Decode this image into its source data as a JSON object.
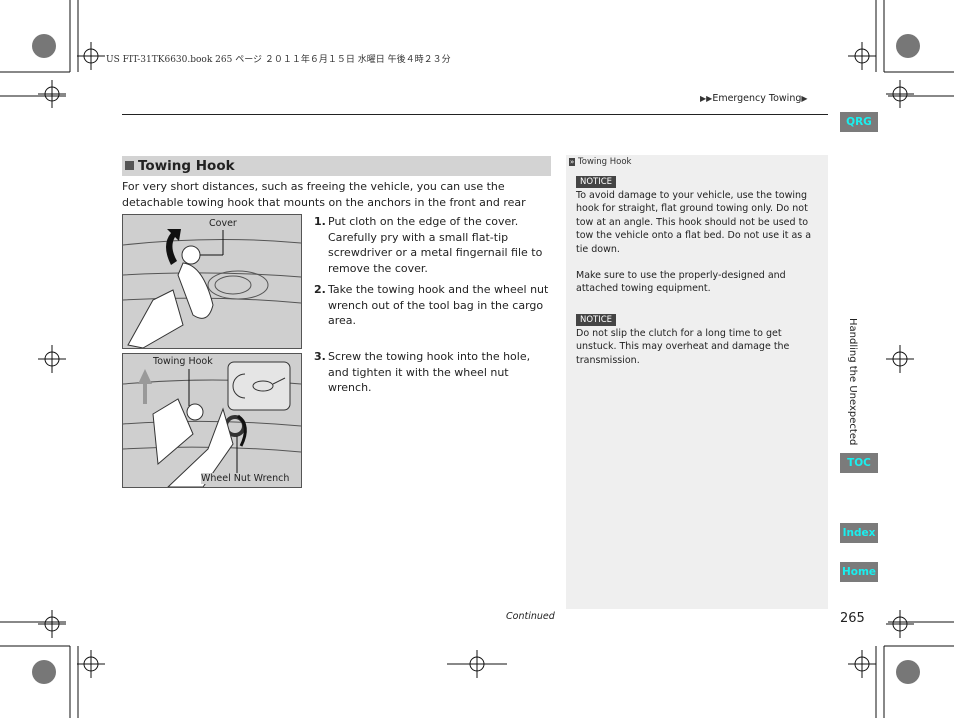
{
  "print_header": "US FIT-31TK6630.book  265 ページ  ２０１１年６月１５日  水曜日  午後４時２３分",
  "breadcrumb": {
    "arrows": "▶▶",
    "label": "Emergency Towing",
    "end": "▶"
  },
  "section": {
    "title": "Towing Hook"
  },
  "intro": "For very short distances, such as freeing the vehicle, you can use the detachable towing hook that mounts on the anchors in the front and rear bumpers.",
  "steps": [
    {
      "num": "1.",
      "text": "Put cloth on the edge of the cover. Carefully pry with a small flat-tip screwdriver or a metal fingernail file to remove the cover."
    },
    {
      "num": "2.",
      "text": "Take the towing hook and the wheel nut wrench out of the tool bag in the cargo area."
    },
    {
      "num": "3.",
      "text": "Screw the towing hook into the hole, and tighten it with the wheel nut wrench."
    }
  ],
  "figures": {
    "fig1_label": "Cover",
    "fig2_label_hook": "Towing Hook",
    "fig2_label_wrench": "Wheel Nut Wrench"
  },
  "sidebar": {
    "ref": "Towing Hook",
    "notice_label": "NOTICE",
    "notice1": "To avoid damage to your vehicle, use the towing hook for straight, flat ground towing only. Do not tow at an angle. This hook should not be used to tow the vehicle onto a flat bed. Do not use it as a tie down.",
    "para": "Make sure to use the properly-designed and attached towing equipment.",
    "notice2": "Do not slip the clutch for a long time to get unstuck. This may overheat and damage the transmission."
  },
  "tabs": {
    "qrg": "QRG",
    "toc": "TOC",
    "index": "Index",
    "home": "Home"
  },
  "chapter": "Handling the Unexpected",
  "page_number": "265",
  "continued": "Continued",
  "colors": {
    "tab_bg": "#7b7b7b",
    "tab_text": "#19f0f0",
    "sidebar_bg": "#efefef",
    "section_bg": "#d3d3d3"
  }
}
